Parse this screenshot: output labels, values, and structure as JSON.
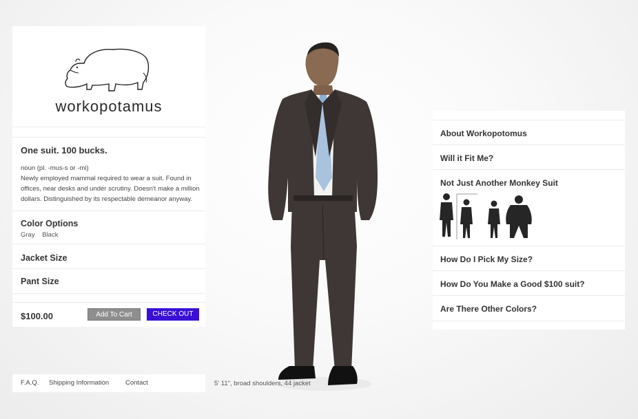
{
  "brand": {
    "name": "workopotamus"
  },
  "product": {
    "tagline": "One suit. 100 bucks.",
    "definition": {
      "pos": "noun (pl. -mus-s or -mi)",
      "body": [
        "Newly employed mammal required to wear a suit. Found in",
        "offices, near desks and under scrutiny. Doesn't make a million",
        "dollars. Distinguished by its respectable demeanor anyway."
      ]
    },
    "color_options": {
      "title": "Color Options",
      "options": [
        "Gray",
        "Black"
      ]
    },
    "jacket_size_label": "Jacket Size",
    "pant_size_label": "Pant Size",
    "price": "$100.00",
    "add_to_cart": "Add To Cart",
    "checkout": "CHECK OUT"
  },
  "footer": {
    "links": [
      "F.A.Q.",
      "Shipping Information",
      "Contact"
    ]
  },
  "model_caption": "5' 11\", broad shoulders, 44 jacket",
  "info_menu": [
    "About Workopotomus",
    "Will it Fit Me?",
    "Not Just Another Monkey Suit",
    "How Do I Pick My Size?",
    "How Do You Make a Good $100 suit?",
    "Are There Other Colors?"
  ],
  "colors": {
    "checkout": "#3b0fd6",
    "cart": "#8e8e8e",
    "suit": "#3e3735",
    "shirt_tie": "#a9c2de"
  },
  "icons": [
    "hippo-logo-icon",
    "silhouette-person-icon"
  ]
}
